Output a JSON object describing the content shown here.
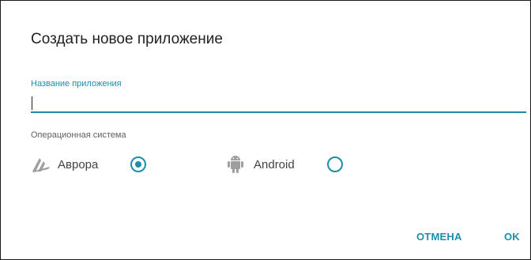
{
  "dialog": {
    "title": "Создать новое приложение",
    "name_field": {
      "label": "Название приложения",
      "value": ""
    },
    "os_section": {
      "label": "Операционная система",
      "options": [
        {
          "label": "Аврора",
          "icon": "aurora-logo-icon",
          "selected": true
        },
        {
          "label": "Android",
          "icon": "android-icon",
          "selected": false
        }
      ]
    },
    "buttons": {
      "cancel": "ОТМЕНА",
      "ok": "OK"
    }
  },
  "colors": {
    "accent": "#1b8fa9",
    "text": "#212121",
    "secondary_text": "#616161",
    "icon": "#9e9e9e"
  }
}
